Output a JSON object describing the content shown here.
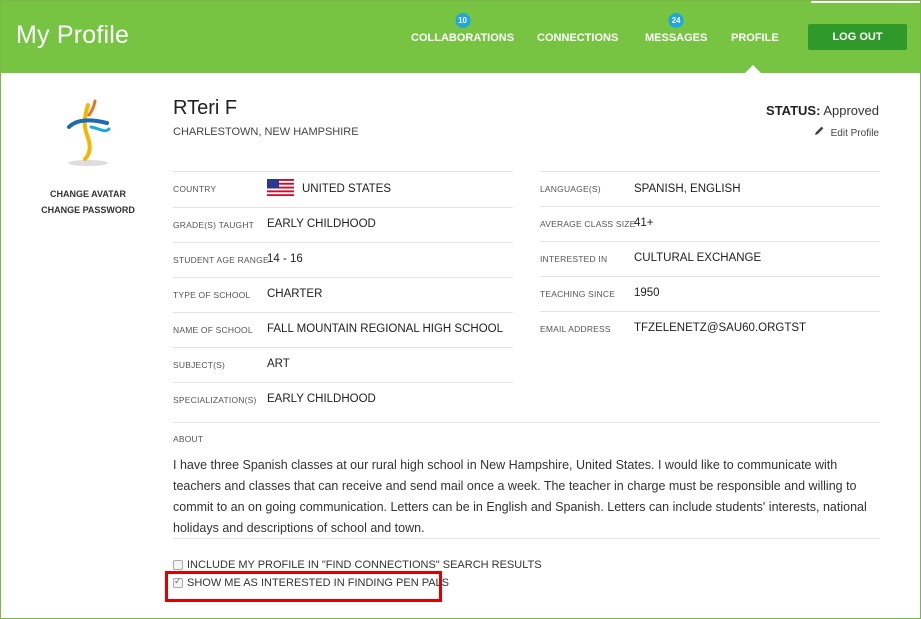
{
  "header": {
    "title": "My Profile",
    "nav": [
      {
        "label": "COLLABORATIONS",
        "badge": "10"
      },
      {
        "label": "CONNECTIONS",
        "badge": ""
      },
      {
        "label": "MESSAGES",
        "badge": "24"
      },
      {
        "label": "PROFILE",
        "badge": ""
      }
    ],
    "logout_label": "LOG OUT"
  },
  "sidebar": {
    "change_avatar": "CHANGE AVATAR",
    "change_password": "CHANGE PASSWORD"
  },
  "profile": {
    "name": "RTeri F",
    "location": "CHARLESTOWN, NEW HAMPSHIRE",
    "status_label": "STATUS:",
    "status_value": "Approved",
    "edit_label": "Edit Profile"
  },
  "fields_left": [
    {
      "label": "COUNTRY",
      "value": "UNITED STATES"
    },
    {
      "label": "GRADE(S) TAUGHT",
      "value": "EARLY CHILDHOOD"
    },
    {
      "label": "STUDENT AGE RANGE",
      "value": "14 - 16"
    },
    {
      "label": "TYPE OF SCHOOL",
      "value": "CHARTER"
    },
    {
      "label": "NAME OF SCHOOL",
      "value": "FALL MOUNTAIN REGIONAL HIGH SCHOOL"
    },
    {
      "label": "SUBJECT(S)",
      "value": "ART"
    },
    {
      "label": "SPECIALIZATION(S)",
      "value": "EARLY CHILDHOOD"
    }
  ],
  "fields_right": [
    {
      "label": "LANGUAGE(S)",
      "value": "SPANISH, ENGLISH"
    },
    {
      "label": "AVERAGE CLASS SIZE",
      "value": "41+"
    },
    {
      "label": "INTERESTED IN",
      "value": "CULTURAL EXCHANGE"
    },
    {
      "label": "TEACHING SINCE",
      "value": "1950"
    },
    {
      "label": "EMAIL ADDRESS",
      "value": "TFZELENETZ@SAU60.ORGTST"
    }
  ],
  "about": {
    "label": "ABOUT",
    "text": "I have three Spanish classes at our rural high school in New Hampshire, United States. I would like to communicate with teachers and classes that can receive and send mail once a week. The teacher in charge must be responsible and willing to commit to an on going communication. Letters can be in English and Spanish. Letters can include students' interests, national holidays and descriptions of school and town."
  },
  "options": {
    "include_search": {
      "label": "INCLUDE MY PROFILE IN \"FIND CONNECTIONS\" SEARCH RESULTS",
      "checked": false
    },
    "pen_pals": {
      "label": "SHOW ME AS INTERESTED IN FINDING PEN PALS",
      "checked": true
    }
  },
  "colors": {
    "header_green": "#76c442",
    "logout_green": "#2f9a2a",
    "badge_blue": "#1ea7de",
    "highlight_red": "#e00000"
  }
}
